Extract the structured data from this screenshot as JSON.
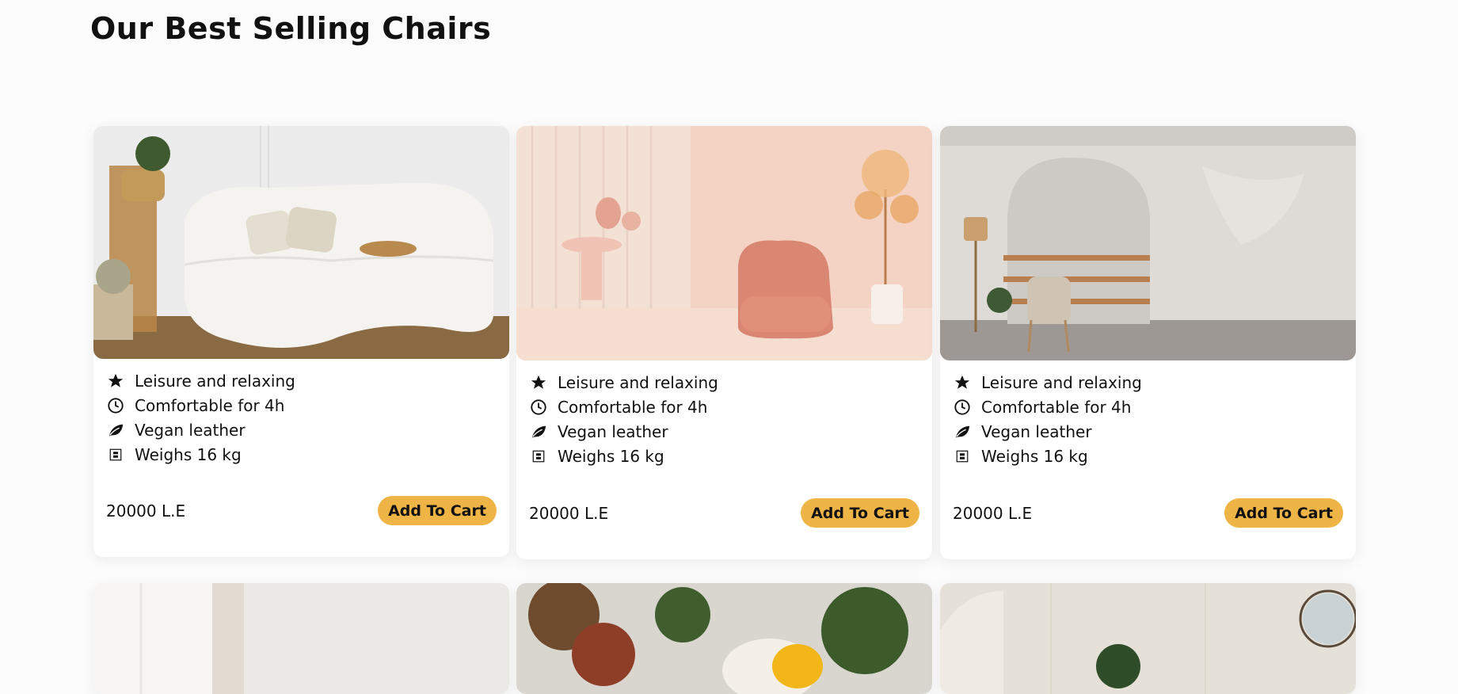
{
  "page": {
    "title": "Our Best Selling Chairs"
  },
  "products": [
    {
      "features": [
        {
          "icon": "star-icon",
          "text": "Leisure and relaxing"
        },
        {
          "icon": "clock-icon",
          "text": "Comfortable for 4h"
        },
        {
          "icon": "leaf-icon",
          "text": "Vegan leather"
        },
        {
          "icon": "weight-icon",
          "text": "Weighs 16 kg"
        }
      ],
      "price": "20000 L.E",
      "cart_label": "Add To Cart"
    },
    {
      "features": [
        {
          "icon": "star-icon",
          "text": "Leisure and relaxing"
        },
        {
          "icon": "clock-icon",
          "text": "Comfortable for 4h"
        },
        {
          "icon": "leaf-icon",
          "text": "Vegan leather"
        },
        {
          "icon": "weight-icon",
          "text": "Weighs 16 kg"
        }
      ],
      "price": "20000 L.E",
      "cart_label": "Add To Cart"
    },
    {
      "features": [
        {
          "icon": "star-icon",
          "text": "Leisure and relaxing"
        },
        {
          "icon": "clock-icon",
          "text": "Comfortable for 4h"
        },
        {
          "icon": "leaf-icon",
          "text": "Vegan leather"
        },
        {
          "icon": "weight-icon",
          "text": "Weighs 16 kg"
        }
      ],
      "price": "20000 L.E",
      "cart_label": "Add To Cart"
    }
  ],
  "colors": {
    "accent": "#efb446",
    "background": "#fdfcfd",
    "text": "#111111"
  }
}
